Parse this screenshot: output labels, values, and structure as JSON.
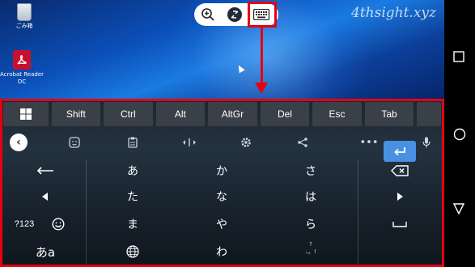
{
  "desktop": {
    "watermark": "4thsight.xyz",
    "icons": [
      {
        "label": "ごみ箱",
        "icon": "recycle-bin-icon"
      },
      {
        "label": "Acrobat Reader DC",
        "icon": "acrobat-icon"
      }
    ]
  },
  "toolbar": {
    "buttons": [
      {
        "name": "zoom-button",
        "icon": "zoom-in-icon"
      },
      {
        "name": "disconnect-button",
        "icon": "disconnect-icon"
      },
      {
        "name": "keyboard-button",
        "icon": "keyboard-icon"
      }
    ]
  },
  "extra_keys": [
    "Shift",
    "Ctrl",
    "Alt",
    "AltGr",
    "Del",
    "Esc",
    "Tab"
  ],
  "suggestion_bar": {
    "icons": [
      "back-icon",
      "sticker-icon",
      "clipboard-icon",
      "cursor-move-icon",
      "settings-icon",
      "share-icon",
      "more-icon",
      "mic-icon"
    ]
  },
  "keys": {
    "row1": [
      "あ",
      "か",
      "さ"
    ],
    "row2": [
      "た",
      "な",
      "は"
    ],
    "row3": [
      "ま",
      "や",
      "ら"
    ],
    "row4": [
      "わ"
    ],
    "mode_123": "?123",
    "mode_kana": "あa",
    "punct_top": "?",
    "punct_mid": "、。!"
  },
  "colors": {
    "highlight": "#e60012",
    "enter": "#4a90e2",
    "extra_key_bg": "#3a4048"
  },
  "navbar": {
    "icons": [
      "overview-icon",
      "home-icon",
      "back-triangle-icon"
    ]
  }
}
